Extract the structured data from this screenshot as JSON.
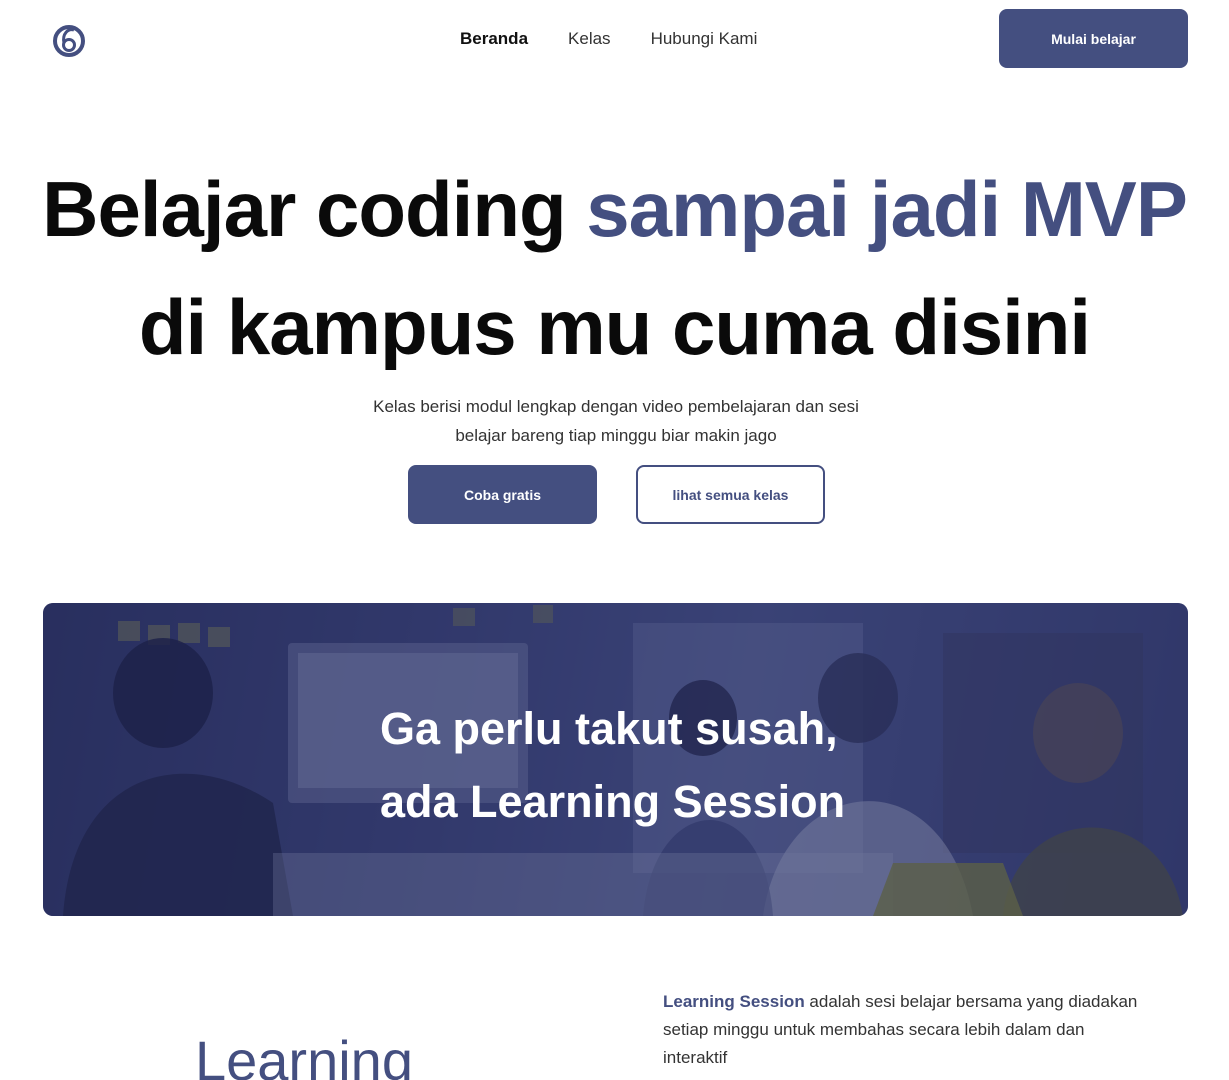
{
  "nav": {
    "links": [
      "Beranda",
      "Kelas",
      "Hubungi Kami"
    ],
    "cta": "Mulai belajar"
  },
  "hero": {
    "title_part1": "Belajar coding ",
    "title_accent": "sampai jadi MVP",
    "title_line2": "di kampus mu cuma disini",
    "subtitle_line1": "Kelas berisi modul lengkap dengan video pembelajaran dan sesi",
    "subtitle_line2": "belajar bareng tiap minggu biar makin jago",
    "btn_primary": "Coba gratis",
    "btn_secondary": "lihat semua kelas"
  },
  "banner": {
    "line1": "Ga perlu takut susah,",
    "line2": "ada Learning Session"
  },
  "learning": {
    "heading": "Learning",
    "desc_strong": "Learning Session",
    "desc_rest": " adalah sesi belajar bersama yang diadakan setiap minggu untuk membahas secara lebih dalam dan interaktif"
  },
  "colors": {
    "accent": "#444f80",
    "text": "#0a0a0a"
  }
}
